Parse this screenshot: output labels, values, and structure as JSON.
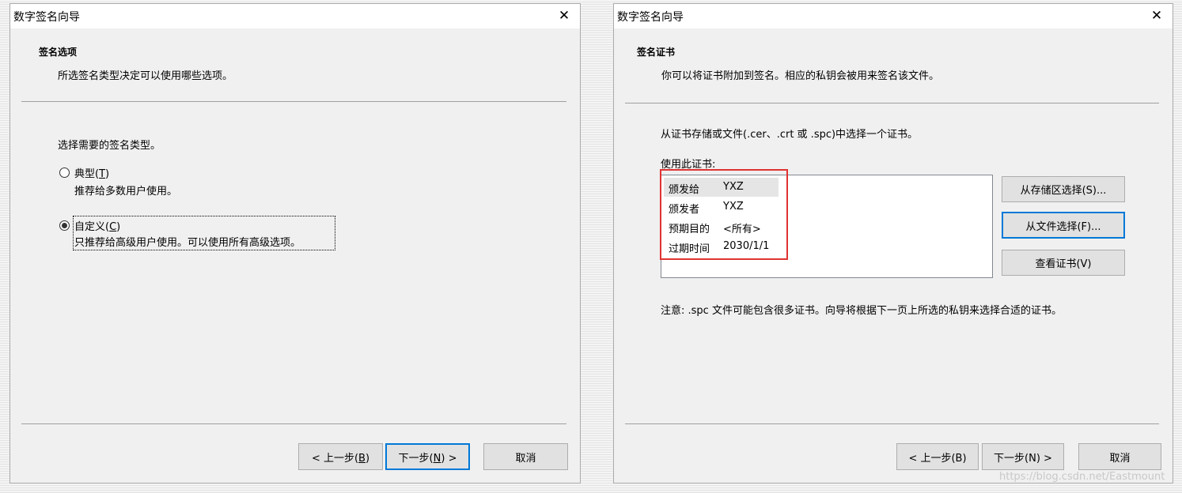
{
  "left": {
    "title": "数字签名向导",
    "heading": "签名选项",
    "description": "所选签名类型决定可以使用哪些选项。",
    "prompt": "选择需要的签名类型。",
    "option_typical": {
      "label": "典型",
      "mnemonic": "T",
      "desc": "推荐给多数用户使用。",
      "selected": false
    },
    "option_custom": {
      "label": "自定义",
      "mnemonic": "C",
      "desc": "只推荐给高级用户使用。可以使用所有高级选项。",
      "selected": true
    },
    "buttons": {
      "back": "< 上一步",
      "back_key": "B",
      "next": "下一步",
      "next_key": "N",
      "next_suffix": " >",
      "cancel": "取消"
    }
  },
  "right": {
    "title": "数字签名向导",
    "heading": "签名证书",
    "description": "你可以将证书附加到签名。相应的私钥会被用来签名该文件。",
    "instruction": "从证书存储或文件(.cer、.crt 或 .spc)中选择一个证书。",
    "use_label": "使用此证书:",
    "cert": [
      {
        "key": "颁发给",
        "value": "YXZ"
      },
      {
        "key": "颁发者",
        "value": "YXZ"
      },
      {
        "key": "预期目的",
        "value": "<所有>"
      },
      {
        "key": "过期时间",
        "value": "2030/1/1"
      }
    ],
    "btn_store": "从存储区选择(S)...",
    "btn_file": "从文件选择(F)...",
    "btn_view": "查看证书(V)",
    "note": "注意: .spc 文件可能包含很多证书。向导将根据下一页上所选的私钥来选择合适的证书。",
    "buttons": {
      "back": "< 上一步(B)",
      "next": "下一步(N) >",
      "cancel": "取消"
    }
  },
  "watermark": "https://blog.csdn.net/Eastmount",
  "colors": {
    "focus_blue": "#0078d7",
    "highlight_red": "#e03232",
    "dialog_bg": "#f0f0f0"
  }
}
